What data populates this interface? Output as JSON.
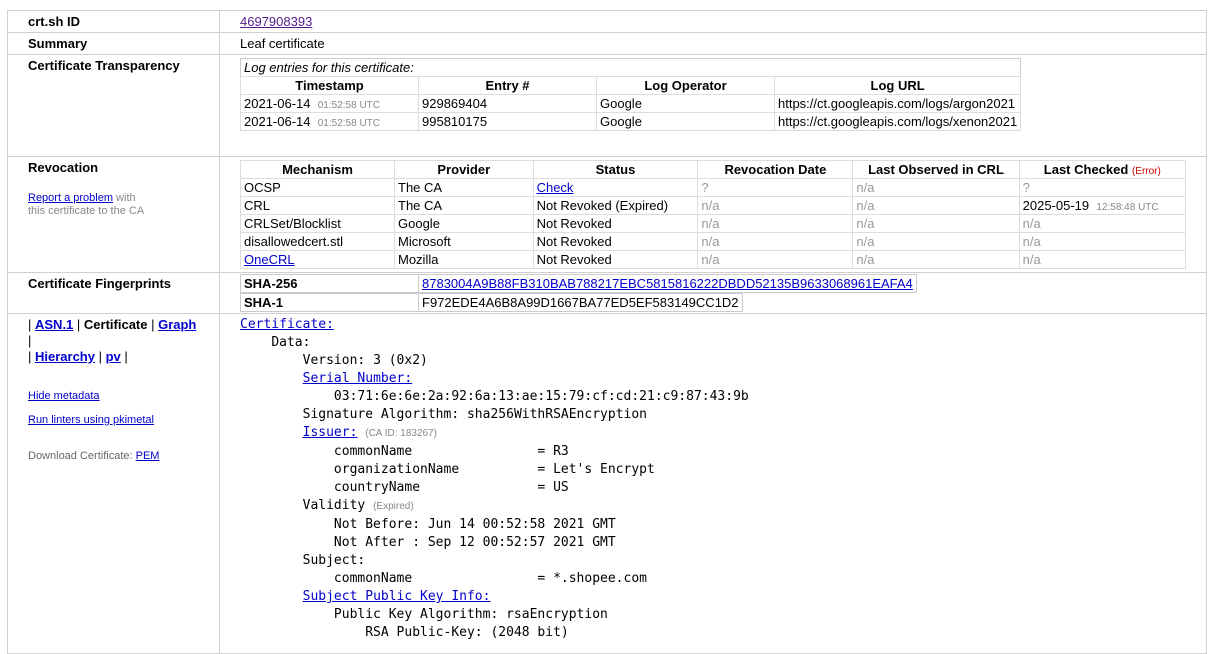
{
  "id_row": {
    "label": "crt.sh ID",
    "value": "4697908393"
  },
  "summary_row": {
    "label": "Summary",
    "value": "Leaf certificate"
  },
  "ct": {
    "label": "Certificate Transparency",
    "caption": "Log entries for this certificate:",
    "headers": [
      "Timestamp",
      "Entry #",
      "Log Operator",
      "Log URL"
    ],
    "rows": [
      {
        "date": "2021-06-14",
        "time": "01:52:58 UTC",
        "entry": "929869404",
        "operator": "Google",
        "url": "https://ct.googleapis.com/logs/argon2021"
      },
      {
        "date": "2021-06-14",
        "time": "01:52:58 UTC",
        "entry": "995810175",
        "operator": "Google",
        "url": "https://ct.googleapis.com/logs/xenon2021"
      }
    ]
  },
  "revocation": {
    "label": "Revocation",
    "report_link": "Report a problem",
    "report_text1": " with",
    "report_text2": "this certificate to the CA",
    "headers": [
      "Mechanism",
      "Provider",
      "Status",
      "Revocation Date",
      "Last Observed in CRL",
      "Last Checked"
    ],
    "error_label": "(Error)",
    "rows": [
      {
        "mechanism": "OCSP",
        "provider": "The CA",
        "status": "Check",
        "rev_date": "?",
        "last_obs": "n/a",
        "last_checked": "?",
        "last_time": ""
      },
      {
        "mechanism": "CRL",
        "provider": "The CA",
        "status": "Not Revoked (Expired)",
        "rev_date": "n/a",
        "last_obs": "n/a",
        "last_checked": "2025-05-19",
        "last_time": "12:58:48 UTC"
      },
      {
        "mechanism": "CRLSet/Blocklist",
        "provider": "Google",
        "status": "Not Revoked",
        "rev_date": "n/a",
        "last_obs": "n/a",
        "last_checked": "n/a",
        "last_time": ""
      },
      {
        "mechanism": "disallowedcert.stl",
        "provider": "Microsoft",
        "status": "Not Revoked",
        "rev_date": "n/a",
        "last_obs": "n/a",
        "last_checked": "n/a",
        "last_time": ""
      },
      {
        "mechanism": "OneCRL",
        "provider": "Mozilla",
        "status": "Not Revoked",
        "rev_date": "n/a",
        "last_obs": "n/a",
        "last_checked": "n/a",
        "last_time": ""
      }
    ]
  },
  "fingerprints": {
    "label": "Certificate Fingerprints",
    "sha256_label": "SHA-256",
    "sha256": "8783004A9B88FB310BAB788217EBC5815816222DBDD52135B9633068961EAFA4",
    "sha1_label": "SHA-1",
    "sha1": "F972EDE4A6B8A99D1667BA77ED5EF583149CC1D2"
  },
  "sidebar": {
    "asn1": "ASN.1",
    "certificate": "Certificate",
    "graph": "Graph",
    "hierarchy": "Hierarchy",
    "pv": "pv",
    "hide_metadata": "Hide metadata",
    "run_linters": "Run linters using pkimetal",
    "download_label": "Download Certificate: ",
    "pem": "PEM"
  },
  "cert": {
    "certificate": "Certificate:",
    "data": "Data:",
    "version": "Version: 3 (0x2)",
    "serial_label": "Serial Number:",
    "serial": "03:71:6e:6e:2a:92:6a:13:ae:15:79:cf:cd:21:c9:87:43:9b",
    "sig_alg": "Signature Algorithm: sha256WithRSAEncryption",
    "issuer_label": "Issuer:",
    "issuer_caid": "(CA ID: 183267)",
    "issuer_cn": "commonName                = R3",
    "issuer_o": "organizationName          = Let's Encrypt",
    "issuer_c": "countryName               = US",
    "validity": "Validity",
    "validity_note": "(Expired)",
    "not_before": "Not Before: Jun 14 00:52:58 2021 GMT",
    "not_after": "Not After : Sep 12 00:52:57 2021 GMT",
    "subject": "Subject:",
    "subject_cn": "commonName                = *.shopee.com",
    "spki_label": "Subject Public Key Info:",
    "pk_alg": "Public Key Algorithm: rsaEncryption",
    "rsa": "RSA Public-Key: (2048 bit)"
  }
}
